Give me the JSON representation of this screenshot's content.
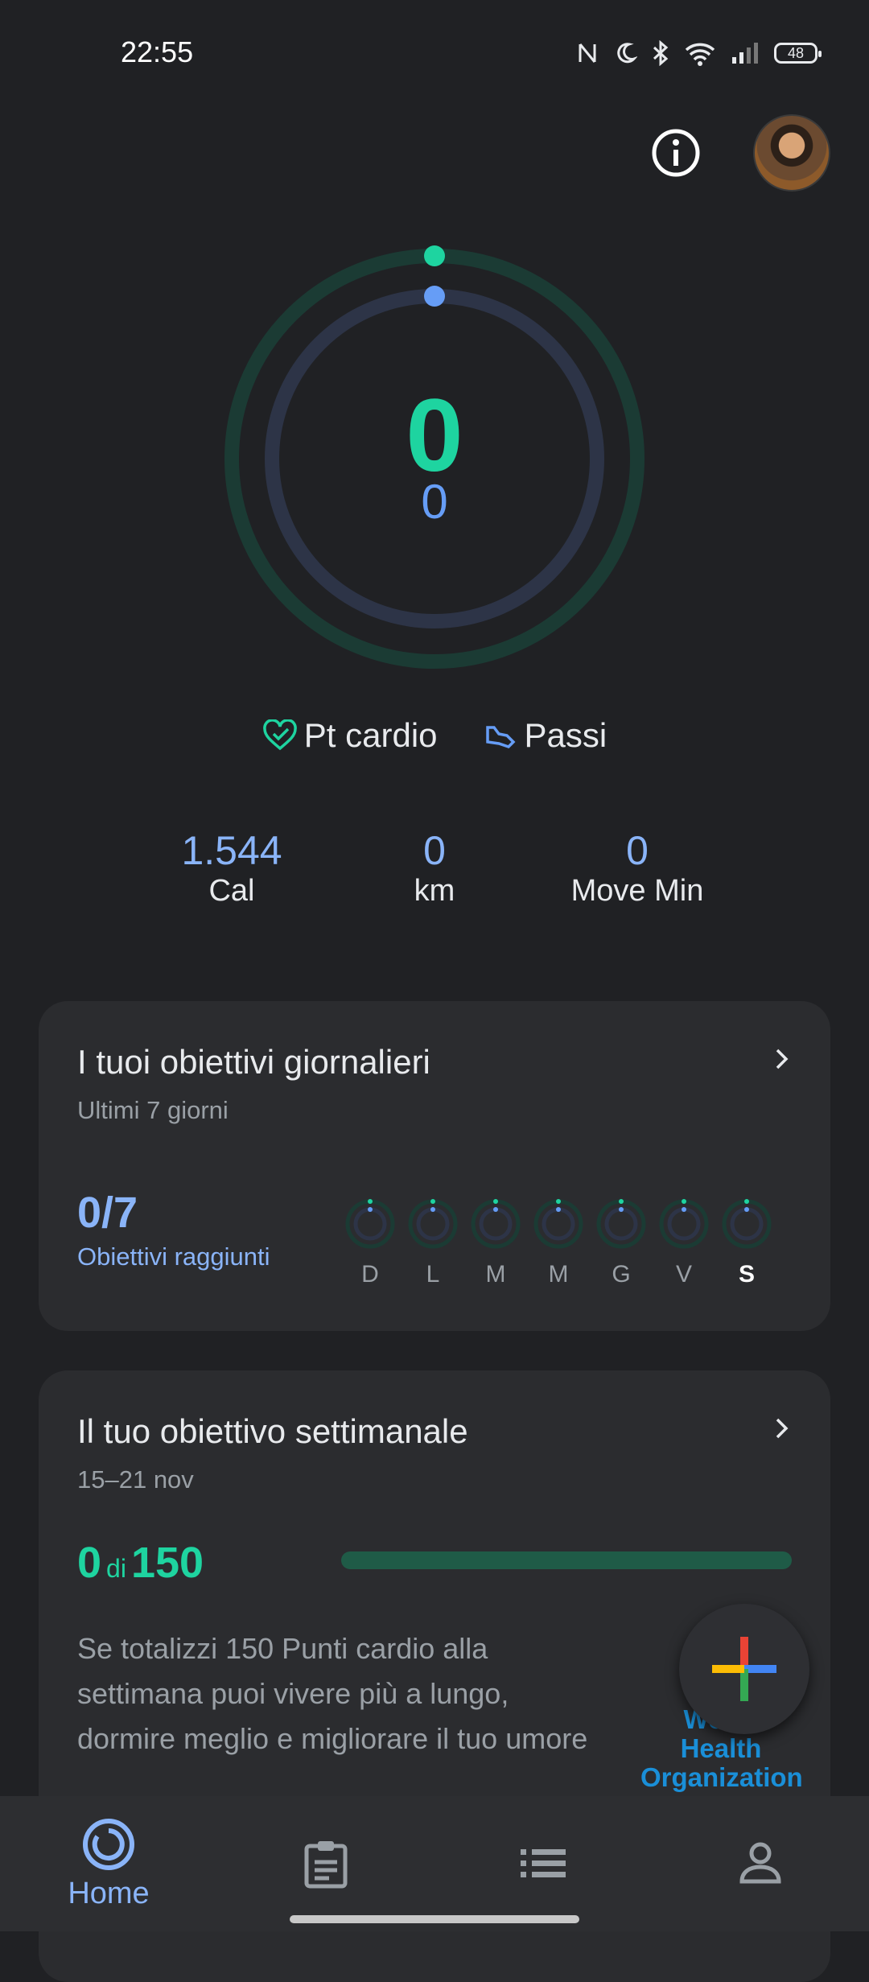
{
  "status_bar": {
    "time": "22:55",
    "battery": "48"
  },
  "rings": {
    "cardio_points": "0",
    "steps": "0"
  },
  "legend": {
    "cardio_label": "Pt cardio",
    "steps_label": "Passi"
  },
  "metrics": [
    {
      "value": "1.544",
      "label": "Cal"
    },
    {
      "value": "0",
      "label": "km"
    },
    {
      "value": "0",
      "label": "Move Min"
    }
  ],
  "daily_goals": {
    "title": "I tuoi obiettivi giornalieri",
    "subtitle": "Ultimi 7 giorni",
    "count": "0/7",
    "count_label": "Obiettivi raggiunti",
    "days": [
      "D",
      "L",
      "M",
      "M",
      "G",
      "V",
      "S"
    ],
    "today_index": 6
  },
  "weekly_goal": {
    "title": "Il tuo obiettivo settimanale",
    "subtitle": "15–21 nov",
    "value": "0",
    "of_label": "di",
    "target": "150",
    "progress": 0,
    "description": "Se totalizzi 150 Punti cardio alla settimana puoi vivere più a lungo, dormire meglio e migliorare il tuo umore",
    "partner_logo": "World Health Organization"
  },
  "bottom_nav": {
    "home_label": "Home"
  },
  "colors": {
    "cardio": "#1ed4a0",
    "steps": "#669df6",
    "accent": "#8ab4f8",
    "background": "#202124"
  }
}
